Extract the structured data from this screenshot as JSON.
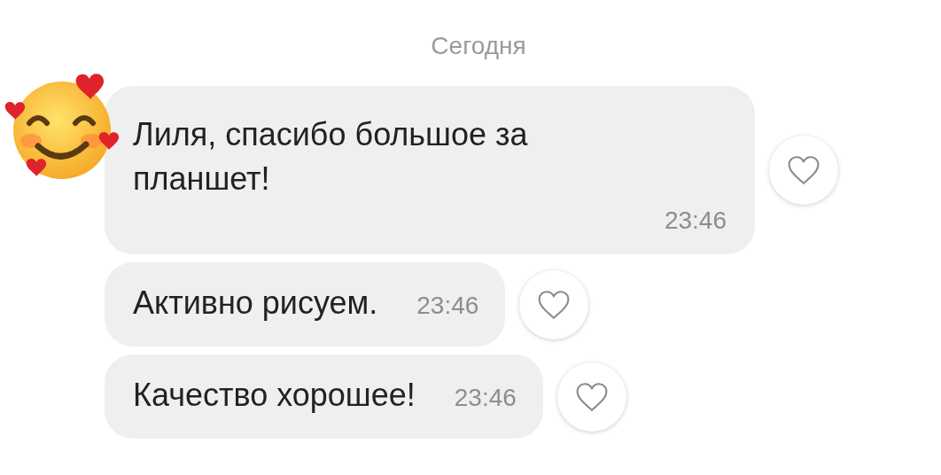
{
  "date_divider": "Сегодня",
  "messages": [
    {
      "kind": "stacked",
      "text": "Лиля, спасибо большое за планшет!",
      "time": "23:46",
      "liked": false,
      "avatar": true
    },
    {
      "kind": "inline",
      "text": "Активно рисуем.",
      "time": "23:46",
      "liked": false,
      "avatar": false
    },
    {
      "kind": "inline",
      "text": "Качество хорошее!",
      "time": "23:46",
      "liked": false,
      "avatar": false
    }
  ]
}
